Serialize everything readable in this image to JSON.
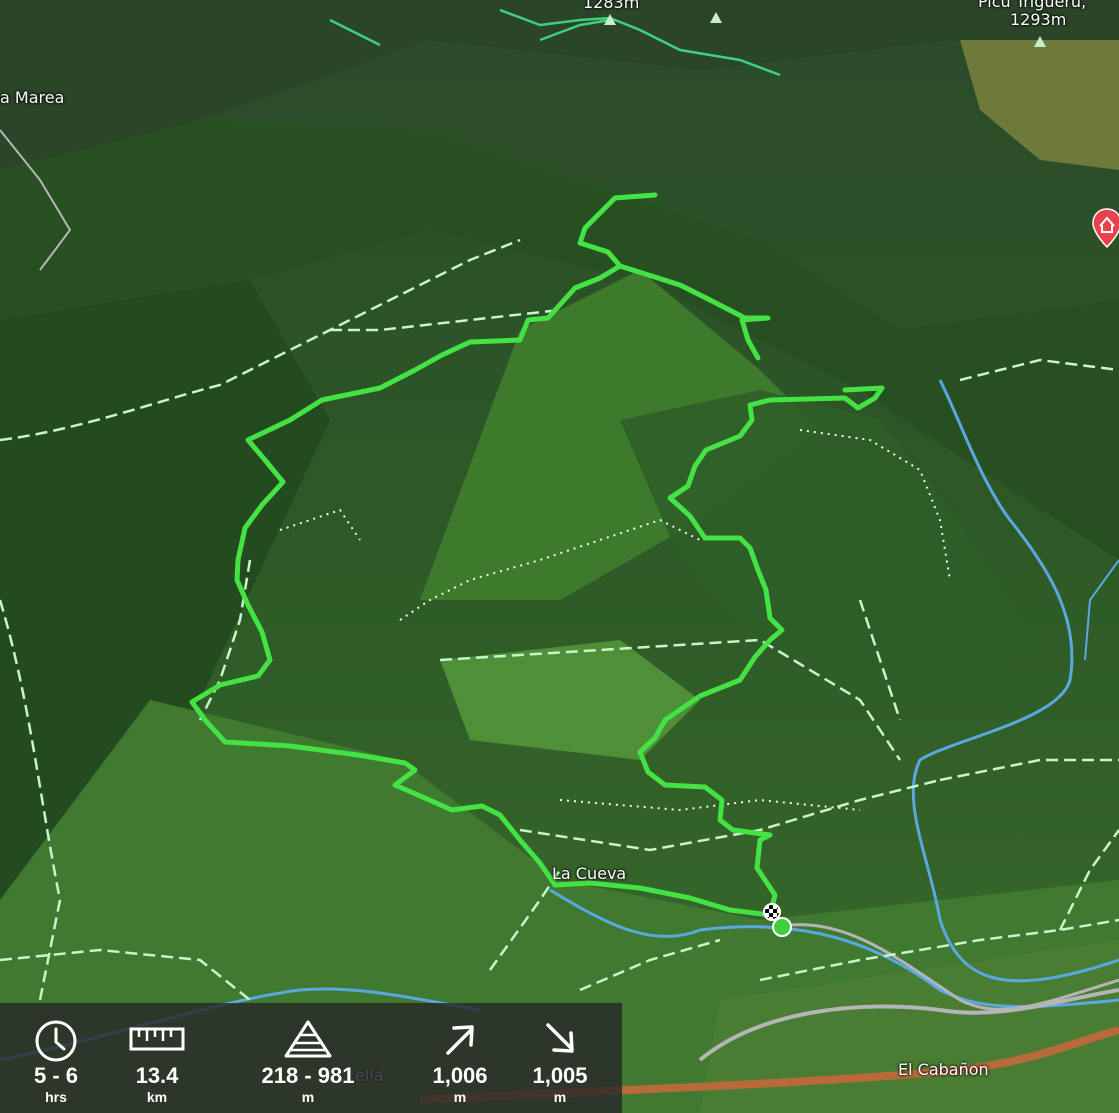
{
  "map": {
    "place_labels": {
      "marea": "a Marea",
      "peak_top": "1283m",
      "picu_name": "Picu Trigueru,",
      "picu_elev": "1293m",
      "la_cueva": "La Cueva",
      "el_cabanon": "El Cabañon",
      "ella": "ella"
    },
    "route_color": "#44e244",
    "trail_color": "#c9f5c9",
    "river_color": "#5aa8e0",
    "road_color": "#b5b5b5",
    "highway_color": "#b86a3a",
    "poi_color": "#e8424f",
    "poi_icon": "lodging-pin-icon"
  },
  "stats": {
    "duration": {
      "icon": "clock-icon",
      "value": "5 - 6",
      "unit": "hrs"
    },
    "distance": {
      "icon": "ruler-icon",
      "value": "13.4",
      "unit": "km"
    },
    "elevation": {
      "icon": "elevation-pyramid-icon",
      "value": "218 - 981",
      "unit": "m"
    },
    "ascent": {
      "icon": "arrow-up-right-icon",
      "value": "1,006",
      "unit": "m"
    },
    "descent": {
      "icon": "arrow-down-right-icon",
      "value": "1,005",
      "unit": "m"
    }
  }
}
